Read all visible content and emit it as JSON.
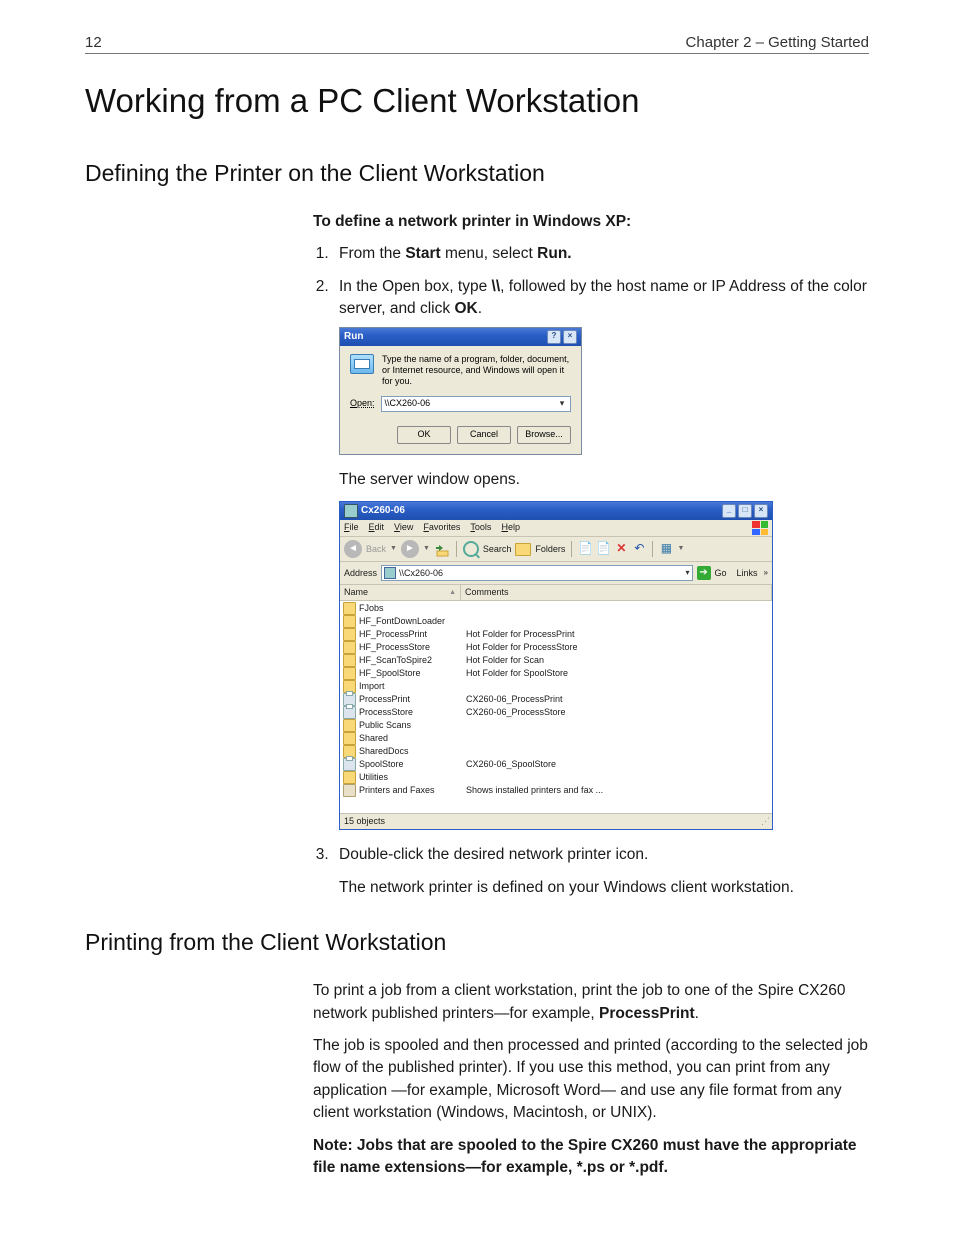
{
  "header": {
    "page_number": "12",
    "chapter": "Chapter 2 – Getting Started"
  },
  "heading_main": "Working from a PC Client Workstation",
  "section1": {
    "heading": "Defining the Printer on the Client Workstation",
    "intro_bold": "To define a network printer in Windows XP:",
    "step1_a": "From the ",
    "step1_b": "Start",
    "step1_c": " menu, select ",
    "step1_d": "Run.",
    "step2_a": "In the Open box, type ",
    "step2_b": "\\\\",
    "step2_c": ", followed by the host name or IP Address of the color server, and click ",
    "step2_d": "OK",
    "step2_e": ".",
    "after_run": "The server window opens.",
    "step3": "Double-click the desired network printer icon.",
    "step3_result": "The network printer is defined on your Windows client workstation."
  },
  "run_dialog": {
    "title": "Run",
    "help": "?",
    "close": "×",
    "message": "Type the name of a program, folder, document, or Internet resource, and Windows will open it for you.",
    "open_label": "Open:",
    "open_value": "\\\\CX260-06",
    "btn_ok": "OK",
    "btn_cancel": "Cancel",
    "btn_browse": "Browse..."
  },
  "explorer": {
    "title": "Cx260-06",
    "min": "_",
    "max": "□",
    "close": "×",
    "menus": [
      "File",
      "Edit",
      "View",
      "Favorites",
      "Tools",
      "Help"
    ],
    "back": "Back",
    "search": "Search",
    "folders": "Folders",
    "address_label": "Address",
    "address_value": "\\\\Cx260-06",
    "go": "Go",
    "links": "Links",
    "col_name": "Name",
    "col_comments": "Comments",
    "rows": [
      {
        "icon": "folder",
        "name": "FJobs",
        "comment": ""
      },
      {
        "icon": "folder",
        "name": "HF_FontDownLoader",
        "comment": ""
      },
      {
        "icon": "folder",
        "name": "HF_ProcessPrint",
        "comment": "Hot Folder for ProcessPrint"
      },
      {
        "icon": "folder",
        "name": "HF_ProcessStore",
        "comment": "Hot Folder for ProcessStore"
      },
      {
        "icon": "folder",
        "name": "HF_ScanToSpire2",
        "comment": "Hot Folder for Scan"
      },
      {
        "icon": "folder",
        "name": "HF_SpoolStore",
        "comment": "Hot Folder for SpoolStore"
      },
      {
        "icon": "folder",
        "name": "Import",
        "comment": ""
      },
      {
        "icon": "printer",
        "name": "ProcessPrint",
        "comment": "CX260-06_ProcessPrint"
      },
      {
        "icon": "printer",
        "name": "ProcessStore",
        "comment": "CX260-06_ProcessStore"
      },
      {
        "icon": "folder",
        "name": "Public Scans",
        "comment": ""
      },
      {
        "icon": "folder",
        "name": "Shared",
        "comment": ""
      },
      {
        "icon": "folder",
        "name": "SharedDocs",
        "comment": ""
      },
      {
        "icon": "printer",
        "name": "SpoolStore",
        "comment": "CX260-06_SpoolStore"
      },
      {
        "icon": "folder",
        "name": "Utilities",
        "comment": ""
      },
      {
        "icon": "pfax",
        "name": "Printers and Faxes",
        "comment": "Shows installed printers and fax ..."
      }
    ],
    "status": "15 objects"
  },
  "section2": {
    "heading": "Printing from the Client Workstation",
    "para1_a": "To print a job from a client workstation, print the job to one of the Spire CX260 network published printers—for example, ",
    "para1_b": "ProcessPrint",
    "para1_c": ".",
    "para2": "The job is spooled and then processed and printed (according to the selected job flow of the published printer). If you use this method, you can print from any application —for example, Microsoft Word— and use any file format from any client workstation (Windows, Macintosh, or UNIX).",
    "note_label": "Note:  ",
    "note_text": "Jobs that are spooled to the Spire CX260 must have the appropriate file name extensions—for example, *.ps or *.pdf."
  }
}
